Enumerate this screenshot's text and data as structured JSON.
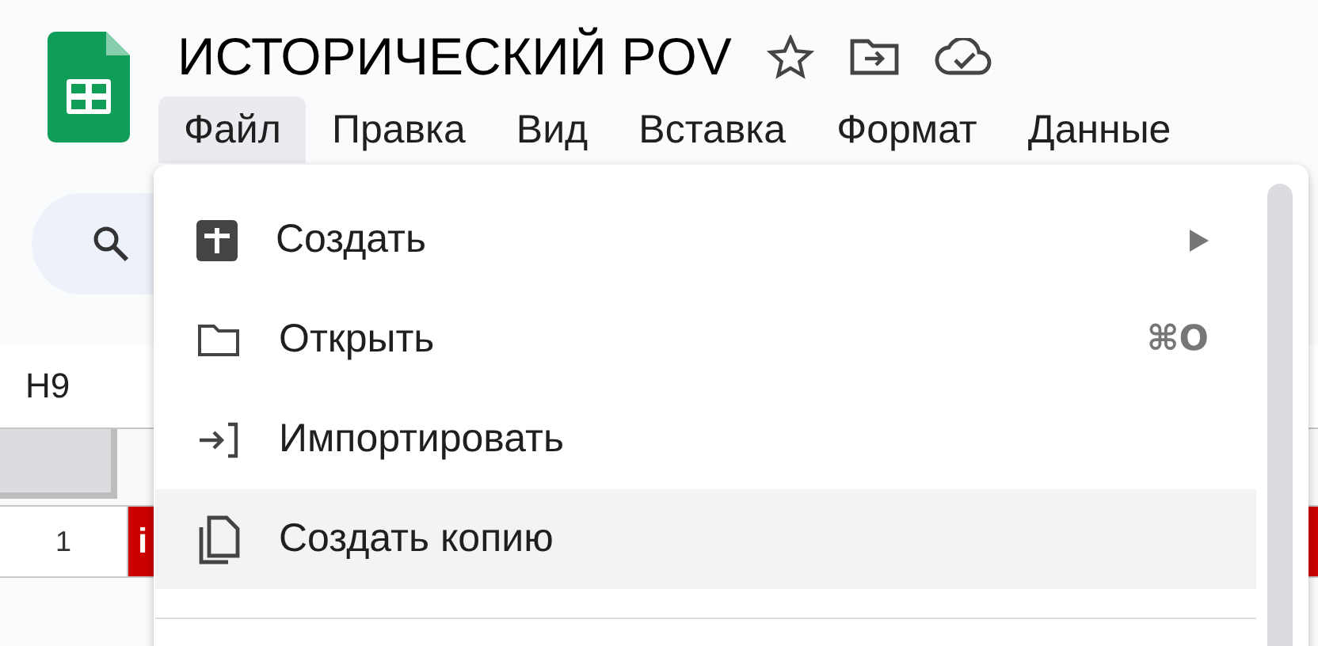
{
  "document": {
    "title": "ИСТОРИЧЕСКИЙ POV"
  },
  "menu_bar": [
    {
      "label": "Файл",
      "selected": true
    },
    {
      "label": "Правка",
      "selected": false
    },
    {
      "label": "Вид",
      "selected": false
    },
    {
      "label": "Вставка",
      "selected": false
    },
    {
      "label": "Формат",
      "selected": false
    },
    {
      "label": "Данные",
      "selected": false
    }
  ],
  "name_box": "H9",
  "sheet": {
    "rows": [
      {
        "number": "1",
        "first_cell": "i"
      }
    ]
  },
  "file_menu": {
    "items": [
      {
        "kind": "create",
        "label": "Создать",
        "submenu": true,
        "selected": false
      },
      {
        "kind": "open",
        "label": "Открыть",
        "shortcut": "⌘O",
        "submenu": false,
        "selected": false
      },
      {
        "kind": "import",
        "label": "Импортировать",
        "submenu": false,
        "selected": false
      },
      {
        "kind": "copy",
        "label": "Создать копию",
        "submenu": false,
        "selected": true
      }
    ]
  }
}
